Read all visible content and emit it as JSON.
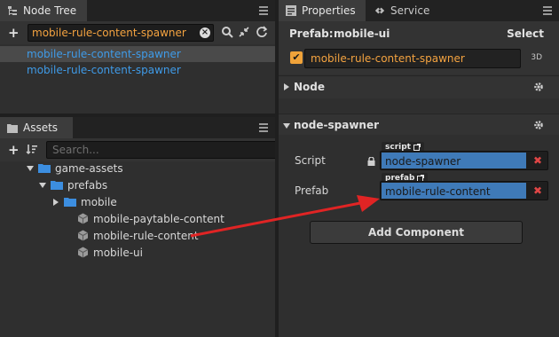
{
  "node_tree": {
    "tab_label": "Node Tree",
    "search_value": "mobile-rule-content-spawner",
    "items": [
      {
        "label": "mobile-rule-content-spawner"
      },
      {
        "label": "mobile-rule-content-spawner"
      }
    ]
  },
  "assets": {
    "tab_label": "Assets",
    "search_placeholder": "Search...",
    "tree": {
      "game_assets": "game-assets",
      "prefabs": "prefabs",
      "mobile": "mobile",
      "files": [
        "mobile-paytable-content",
        "mobile-rule-content",
        "mobile-ui"
      ]
    }
  },
  "properties": {
    "tabs": [
      {
        "label": "Properties"
      },
      {
        "label": "Service"
      }
    ],
    "prefab_label": "Prefab:",
    "prefab_value": "mobile-ui",
    "select_label": "Select",
    "node_name": "mobile-rule-content-spawner",
    "tag_3d": "3D",
    "node_section": "Node",
    "component_section": "node-spawner",
    "script_label": "Script",
    "script_tag": "script",
    "script_value": "node-spawner",
    "prefab_prop_label": "Prefab",
    "prefab_tag": "prefab",
    "prefab_prop_value": "mobile-rule-content",
    "add_component": "Add Component"
  },
  "colors": {
    "accent_orange": "#f4a340",
    "link_blue": "#3f9be8",
    "field_blue": "#3f7ab8",
    "remove_red": "#e04646",
    "annotation_arrow": "#e02424"
  }
}
